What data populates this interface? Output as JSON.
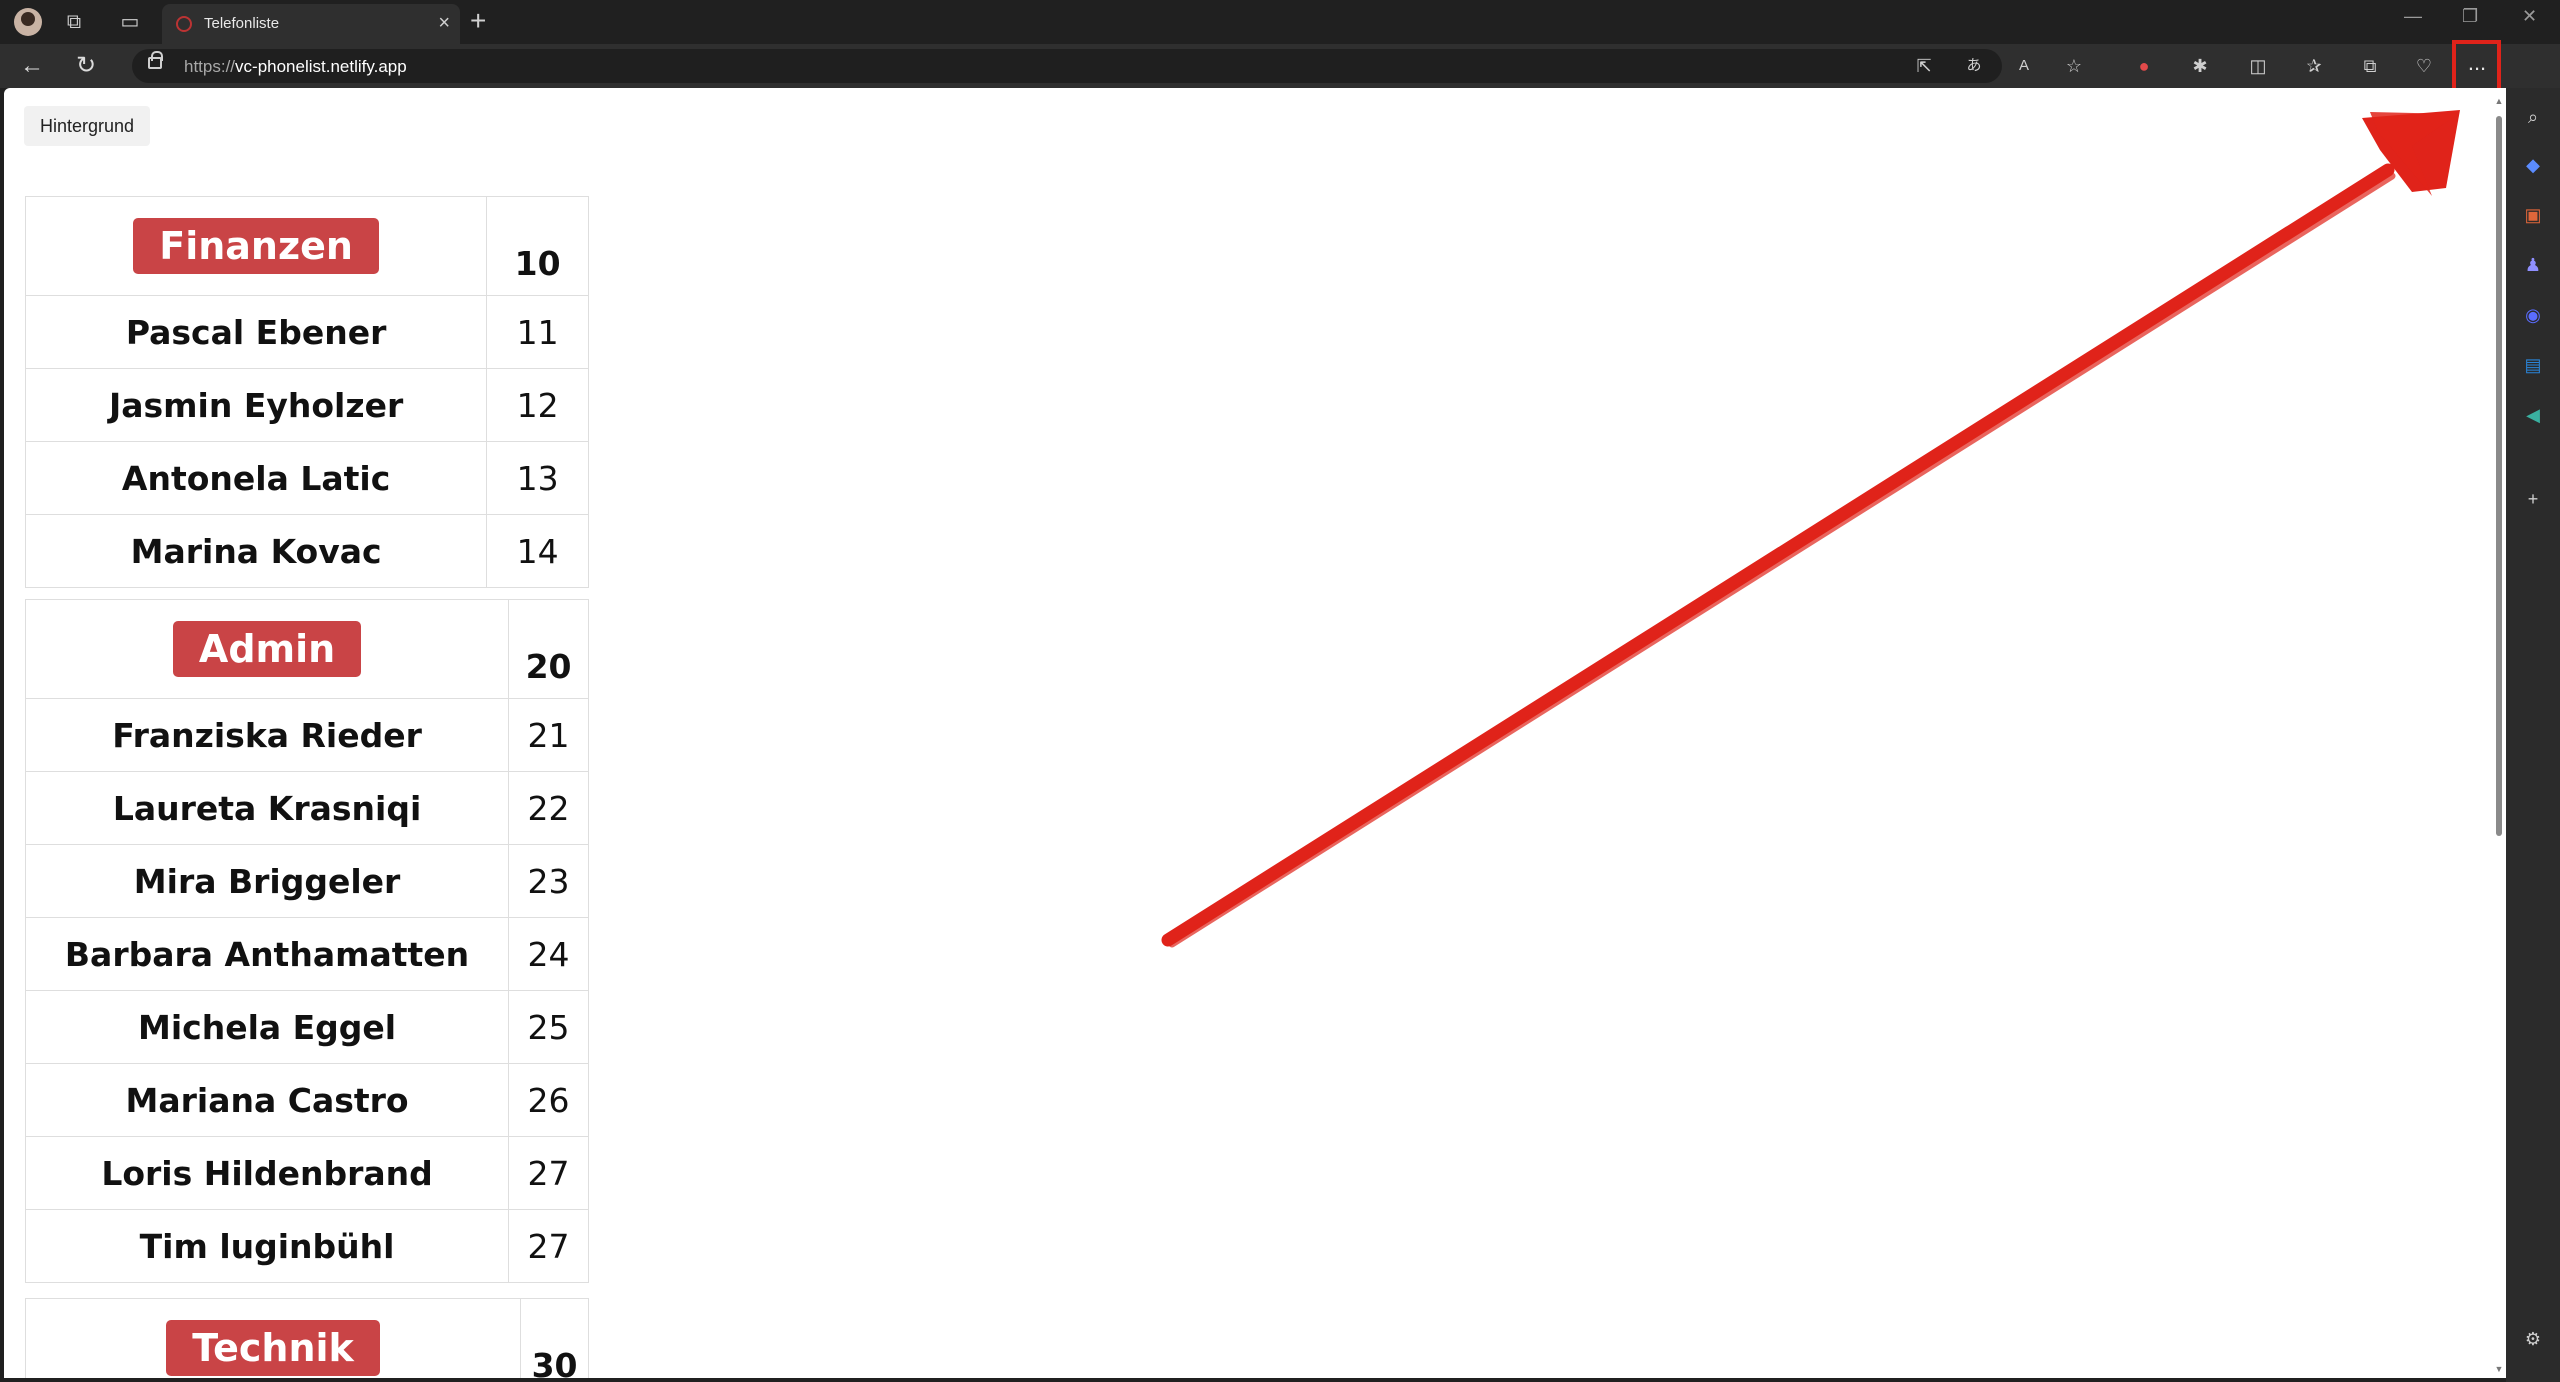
{
  "browser": {
    "tab_title": "Telefonliste",
    "url_protocol": "https://",
    "url_host": "vc-phonelist.netlify.app",
    "more_icon": "...",
    "minimize": "—",
    "restore": "❐",
    "close": "✕"
  },
  "page": {
    "background_button": "Hintergrund"
  },
  "groups": [
    {
      "department": "Finanzen",
      "number": "10",
      "members": [
        {
          "name": "Pascal Ebener",
          "ext": "11"
        },
        {
          "name": "Jasmin Eyholzer",
          "ext": "12"
        },
        {
          "name": "Antonela Latic",
          "ext": "13"
        },
        {
          "name": "Marina Kovac",
          "ext": "14"
        }
      ]
    },
    {
      "department": "Admin",
      "number": "20",
      "members": [
        {
          "name": "Franziska Rieder",
          "ext": "21"
        },
        {
          "name": "Laureta Krasniqi",
          "ext": "22"
        },
        {
          "name": "Mira Briggeler",
          "ext": "23"
        },
        {
          "name": "Barbara Anthamatten",
          "ext": "24"
        },
        {
          "name": "Michela Eggel",
          "ext": "25"
        },
        {
          "name": "Mariana Castro",
          "ext": "26"
        },
        {
          "name": "Loris Hildenbrand",
          "ext": "27"
        },
        {
          "name": "Tim luginbühl",
          "ext": "27"
        }
      ]
    },
    {
      "department": "Technik",
      "number": "30",
      "members": []
    }
  ],
  "colors": {
    "department_badge": "#c94446",
    "annotation": "#e0231a"
  }
}
